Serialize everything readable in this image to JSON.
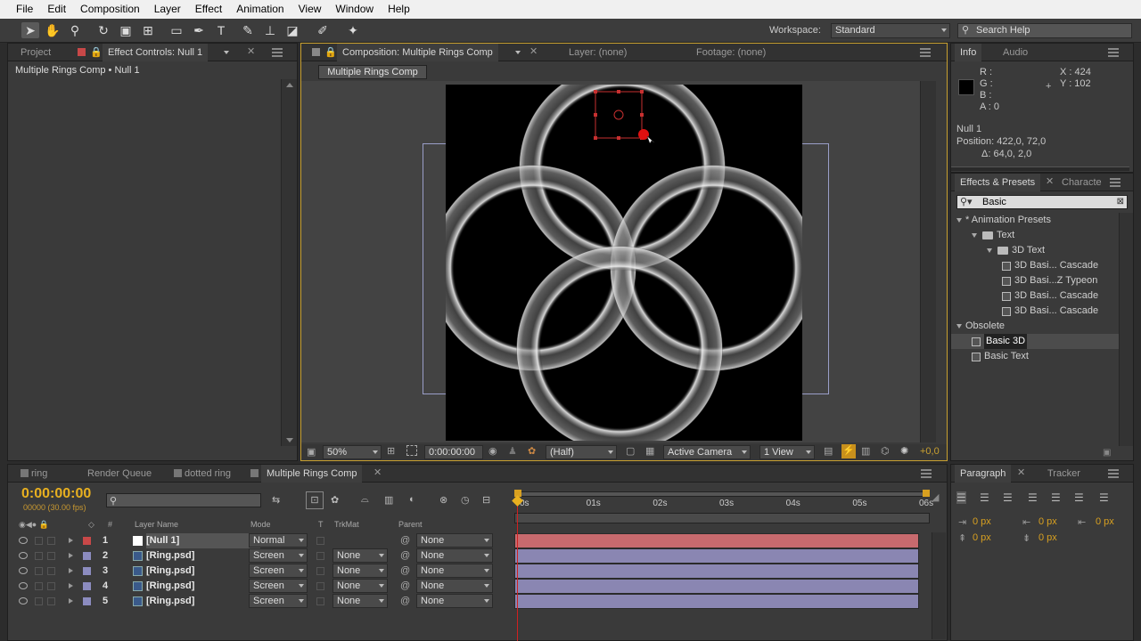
{
  "menu": [
    "File",
    "Edit",
    "Composition",
    "Layer",
    "Effect",
    "Animation",
    "View",
    "Window",
    "Help"
  ],
  "toolbar": {
    "workspace_label": "Workspace:",
    "workspace_value": "Standard",
    "search_help_placeholder": "Search Help"
  },
  "project_panel": {
    "tab_project": "Project",
    "tab_effect_controls": "Effect Controls: Null 1",
    "breadcrumb": "Multiple Rings Comp • Null 1"
  },
  "comp_panel": {
    "tab_comp": "Composition: Multiple Rings Comp",
    "tab_layer": "Layer: (none)",
    "tab_footage": "Footage: (none)",
    "comp_button": "Multiple Rings Comp",
    "zoom": "50%",
    "timecode": "0:00:00:00",
    "resolution": "(Half)",
    "camera": "Active Camera",
    "views": "1 View",
    "exposure": "+0,0"
  },
  "info_panel": {
    "tab_info": "Info",
    "tab_audio": "Audio",
    "r_label": "R :",
    "g_label": "G :",
    "b_label": "B :",
    "a_label": "A : 0",
    "x": "X : 424",
    "y": "Y : 102",
    "layer_name": "Null 1",
    "position": "Position: 422,0, 72,0",
    "delta": "Δ: 64,0, 2,0"
  },
  "effects_panel": {
    "tab_effects": "Effects & Presets",
    "tab_character": "Characte",
    "search_value": "Basic",
    "tree": [
      {
        "label": "* Animation Presets",
        "indent": 0,
        "type": "folder-open"
      },
      {
        "label": "Text",
        "indent": 1,
        "type": "folder"
      },
      {
        "label": "3D Text",
        "indent": 2,
        "type": "folder"
      },
      {
        "label": "3D Basi... Cascade",
        "indent": 3,
        "type": "preset"
      },
      {
        "label": "3D Basi...Z Typeon",
        "indent": 3,
        "type": "preset"
      },
      {
        "label": "3D Basi... Cascade",
        "indent": 3,
        "type": "preset"
      },
      {
        "label": "3D Basi... Cascade",
        "indent": 3,
        "type": "preset"
      },
      {
        "label": "Obsolete",
        "indent": 0,
        "type": "folder-open"
      },
      {
        "label": "Basic 3D",
        "indent": 1,
        "type": "effect",
        "selected": true
      },
      {
        "label": "Basic Text",
        "indent": 1,
        "type": "effect"
      }
    ]
  },
  "timeline": {
    "tabs": [
      "ring",
      "Render Queue",
      "dotted ring",
      "Multiple Rings Comp"
    ],
    "timecode": "0:00:00:00",
    "fps": "00000 (30.00 fps)",
    "columns": {
      "num": "#",
      "layer_name": "Layer Name",
      "mode": "Mode",
      "t": "T",
      "trkmat": "TrkMat",
      "parent": "Parent"
    },
    "ruler": [
      "0s",
      "01s",
      "02s",
      "03s",
      "04s",
      "05s",
      "06s"
    ],
    "layers": [
      {
        "num": "1",
        "name": "[Null 1]",
        "mode": "Normal",
        "trkmat": "",
        "parent": "None",
        "color": "#c84848",
        "bar": "#c86a6e"
      },
      {
        "num": "2",
        "name": "[Ring.psd]",
        "mode": "Screen",
        "trkmat": "None",
        "parent": "None",
        "color": "#8c8cc0",
        "bar": "#8a86b2"
      },
      {
        "num": "3",
        "name": "[Ring.psd]",
        "mode": "Screen",
        "trkmat": "None",
        "parent": "None",
        "color": "#8c8cc0",
        "bar": "#8a86b2"
      },
      {
        "num": "4",
        "name": "[Ring.psd]",
        "mode": "Screen",
        "trkmat": "None",
        "parent": "None",
        "color": "#8c8cc0",
        "bar": "#8a86b2"
      },
      {
        "num": "5",
        "name": "[Ring.psd]",
        "mode": "Screen",
        "trkmat": "None",
        "parent": "None",
        "color": "#8c8cc0",
        "bar": "#8a86b2"
      }
    ]
  },
  "paragraph_panel": {
    "tab_paragraph": "Paragraph",
    "tab_tracker": "Tracker",
    "indent_left": "0 px",
    "indent_right": "0 px",
    "indent_first": "0 px",
    "space_before": "0 px",
    "space_after": "0 px"
  }
}
